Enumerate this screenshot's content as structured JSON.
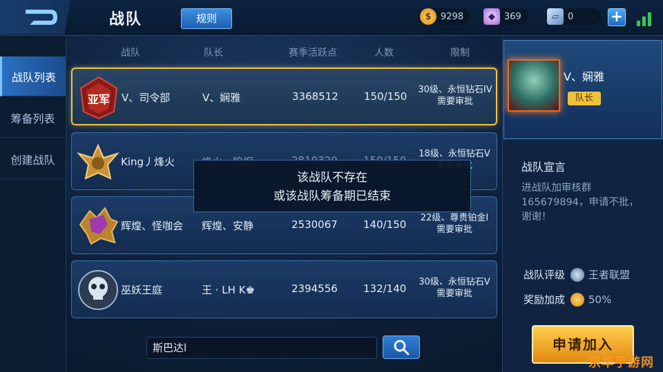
{
  "header": {
    "title": "战队",
    "rules_label": "规则",
    "resources": [
      {
        "icon": "coin-icon",
        "value": "9298"
      },
      {
        "icon": "diamond-icon",
        "value": "369"
      },
      {
        "icon": "ticket-icon",
        "value": "0"
      }
    ],
    "add_label": "+"
  },
  "sidebar": {
    "items": [
      {
        "label": "战队列表",
        "active": true
      },
      {
        "label": "筹备列表",
        "active": false
      },
      {
        "label": "创建战队",
        "active": false
      }
    ]
  },
  "columns": [
    "战队",
    "队长",
    "赛季活跃点",
    "人数",
    "限制"
  ],
  "teams": [
    {
      "emblem": "crimson-army-emblem-icon",
      "emblem_text": "亚军",
      "name": "V、司令部",
      "captain": "V、娴雅",
      "activity": "3368512",
      "members": "150/150",
      "limit_line1": "30级、永恒钻石IV",
      "limit_line2": "需要审批",
      "selected": true
    },
    {
      "emblem": "gold-eagle-emblem-icon",
      "name": "King丿烽火",
      "captain": "烽火、狼烟",
      "activity": "2810320",
      "members": "150/150",
      "limit_line1": "18级、永恒钻石V",
      "limit_line2": "需要审批",
      "selected": false
    },
    {
      "emblem": "dragon-emblem-icon",
      "name": "辉煌、怪咖会",
      "captain": "辉煌、安静",
      "activity": "2530067",
      "members": "140/150",
      "limit_line1": "22级、尊贵铂金I",
      "limit_line2": "需要审批",
      "selected": false
    },
    {
      "emblem": "skull-emblem-icon",
      "name": "巫妖王庭",
      "captain": "王 · LH K♚",
      "activity": "2394556",
      "members": "132/140",
      "limit_line1": "30级、永恒钻石V",
      "limit_line2": "需要审批",
      "selected": false
    }
  ],
  "toast": {
    "line1": "该战队不存在",
    "line2": "或该战队筹备期已结束"
  },
  "search": {
    "value": "斯巴达l"
  },
  "leader": {
    "name": "V、娴雅",
    "badge": "队长"
  },
  "declaration": {
    "title": "战队宣言",
    "text": "进战队加审核群165679894，申请不批，谢谢！"
  },
  "rating": {
    "label": "战队评级",
    "value": "王者联盟"
  },
  "bonus": {
    "label": "奖励加成",
    "value": "50%"
  },
  "apply_label": "申请加入",
  "watermark": "京华手游网"
}
